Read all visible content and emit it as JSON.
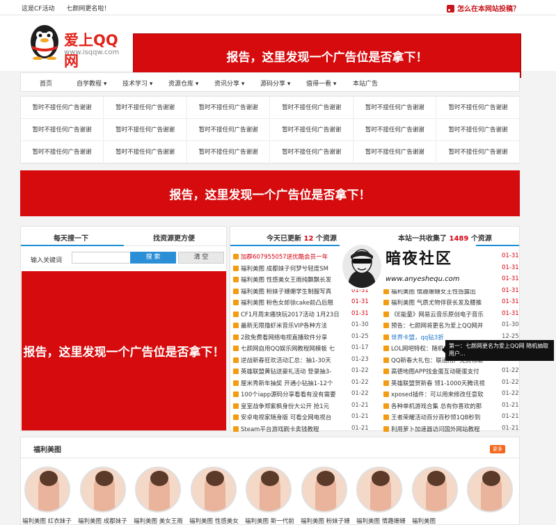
{
  "topbar": {
    "links": [
      "这是CF活动",
      "七颜网更名啦！"
    ],
    "submit": "怎么在本网站投稿？"
  },
  "logo": {
    "name": "爱上QQ网",
    "url": "www.isqqw.com"
  },
  "ads": {
    "top": "报告，这里发现一个广告位是否拿下！",
    "middle": "报告，这里发现一个广告位是否拿下！",
    "left": "报告，这里发现一个广告位是否拿下！"
  },
  "nav": {
    "items": [
      "首页",
      "自学教程 ▾",
      "技术学习 ▾",
      "资源仓库 ▾",
      "资讯分享 ▾",
      "源码分享 ▾",
      "值得一看 ▾",
      "本站广告"
    ]
  },
  "ad_grid": {
    "cells": [
      "暂时不接任何广告谢谢",
      "暂时不接任何广告谢谢",
      "暂时不接任何广告谢谢",
      "暂时不接任何广告谢谢",
      "暂时不接任何广告谢谢",
      "暂时不接任何广告谢谢",
      "暂时不接任何广告谢谢",
      "暂时不接任何广告谢谢",
      "暂时不接任何广告谢谢",
      "暂时不接任何广告谢谢",
      "暂时不接任何广告谢谢",
      "暂时不接任何广告谢谢",
      "暂时不接任何广告谢谢",
      "暂时不接任何广告谢谢",
      "暂时不接任何广告谢谢",
      "暂时不接任何广告谢谢",
      "暂时不接任何广告谢谢",
      "暂时不接任何广告谢谢"
    ]
  },
  "search_panel": {
    "tab1": "每天搜一下",
    "tab2": "找资源更方便",
    "keyword_label": "输入关键词",
    "input_value": "",
    "search_button": "搜 索",
    "clear_button": "清 空"
  },
  "stats": {
    "today_prefix": "今天已更新",
    "today_count": "12",
    "today_suffix": "个资源",
    "total_prefix": "本站一共收集了",
    "total_count": "1489",
    "total_suffix": "个资源"
  },
  "list_left": [
    {
      "title": "加群607955057送优酷会员一年",
      "date": "01-31",
      "title_style": "red",
      "date_style": "red"
    },
    {
      "title": "福利美图 成都妹子何梦兮轻度SM",
      "date": "01-31",
      "title_style": "",
      "date_style": "red"
    },
    {
      "title": "福利美图 性感美女王雨纯飘飘长发",
      "date": "01-31",
      "title_style": "",
      "date_style": "red"
    },
    {
      "title": "福利美图 粉妹子姗姗学生制服写真",
      "date": "01-31",
      "title_style": "",
      "date_style": "red"
    },
    {
      "title": "福利美图 粉色女郎徐cake前凸后翘",
      "date": "01-31",
      "title_style": "",
      "date_style": "red"
    },
    {
      "title": "CF1月周末痛快玩2017活动 1月23日",
      "date": "01-31",
      "title_style": "",
      "date_style": "red"
    },
    {
      "title": "最新无限撸虾米音乐VIP各种方法",
      "date": "01-30",
      "title_style": "",
      "date_style": ""
    },
    {
      "title": "2款免费看网络电视直播软件分享",
      "date": "01-25",
      "title_style": "",
      "date_style": ""
    },
    {
      "title": "七颜网自用QQ娱乐网教程网模板 七",
      "date": "01-17",
      "title_style": "",
      "date_style": ""
    },
    {
      "title": "逆战新春狂欢活动汇总：抽1-30天",
      "date": "01-23",
      "title_style": "",
      "date_style": ""
    },
    {
      "title": "英雄联盟黄钻送豪礼活动 登录抽3-",
      "date": "01-22",
      "title_style": "",
      "date_style": ""
    },
    {
      "title": "厘米秀新年抽奖 开通小钻抽1-12个",
      "date": "01-22",
      "title_style": "",
      "date_style": ""
    },
    {
      "title": "100个iapp源码分享看看有没有需要",
      "date": "01-22",
      "title_style": "",
      "date_style": ""
    },
    {
      "title": "皇室战争郑紫枫身份大公开 抢1元",
      "date": "01-21",
      "title_style": "",
      "date_style": ""
    },
    {
      "title": "安卓电视家随身版 可看全网电视台",
      "date": "01-21",
      "title_style": "",
      "date_style": ""
    },
    {
      "title": "Steam平台游戏刷卡卖钱教程",
      "date": "01-21",
      "title_style": "",
      "date_style": ""
    }
  ],
  "list_right": [
    {
      "title": "",
      "date": "01-31",
      "title_style": "",
      "date_style": "red"
    },
    {
      "title": "",
      "date": "01-31",
      "title_style": "",
      "date_style": "red"
    },
    {
      "title": "",
      "date": "01-31",
      "title_style": "",
      "date_style": "red"
    },
    {
      "title": "福利美图 情趣姗姗女王性感露出",
      "date": "01-31",
      "title_style": "",
      "date_style": "red"
    },
    {
      "title": "福利美图 气质尤物俘获长发及腰推",
      "date": "01-31",
      "title_style": "",
      "date_style": "red"
    },
    {
      "title": "《E能量》网易云音乐原创电子音乐",
      "date": "01-31",
      "title_style": "",
      "date_style": "red"
    },
    {
      "title": "预告：七颜网将更名为爱上QQ网并",
      "date": "01-30",
      "title_style": "",
      "date_style": ""
    },
    {
      "title": "世界卡盟，qq钻3折",
      "date": "12-25",
      "title_style": "blue",
      "date_style": ""
    },
    {
      "title": "LOL网吧特权：随机抽取",
      "date": "",
      "title_style": "",
      "date_style": ""
    },
    {
      "title": "QQ新春大礼包：联通用户免费领取",
      "date": "",
      "title_style": "",
      "date_style": ""
    },
    {
      "title": "高德地图APP找金蛋互动砸蛋支付",
      "date": "01-22",
      "title_style": "",
      "date_style": ""
    },
    {
      "title": "英雄联盟贺新春 领1-1000天腾讯视",
      "date": "01-22",
      "title_style": "",
      "date_style": ""
    },
    {
      "title": "xposed插件：可以用来修改任意软",
      "date": "01-22",
      "title_style": "",
      "date_style": ""
    },
    {
      "title": "各种单机游戏合集 总有你喜欢的那",
      "date": "01-21",
      "title_style": "",
      "date_style": ""
    },
    {
      "title": "王者荣耀活动百分百秒领1QB秒到",
      "date": "01-21",
      "title_style": "",
      "date_style": ""
    },
    {
      "title": "利用萝卜加速器访问国外网站教程",
      "date": "01-21",
      "title_style": "",
      "date_style": ""
    }
  ],
  "watermark": {
    "title": "暗夜社区",
    "url": "www.anyeshequ.com"
  },
  "tooltip": {
    "text": "第一：七颜网更名为爱上QQ网 随机抽取 用户..."
  },
  "gallery": {
    "title": "福利美图",
    "more": "更多",
    "captions": [
      "福利美图 红衣妹子",
      "福利美图 成都妹子",
      "福利美图 美女王雨",
      "福利美图 性感美女",
      "福利美图 新一代前",
      "福利美图 粉妹子姗",
      "福利美图 情趣姗姗",
      "福利美图"
    ]
  },
  "colors": {
    "accent": "#d60b0d",
    "blue": "#1b8fd6",
    "orange": "#f39c12"
  }
}
